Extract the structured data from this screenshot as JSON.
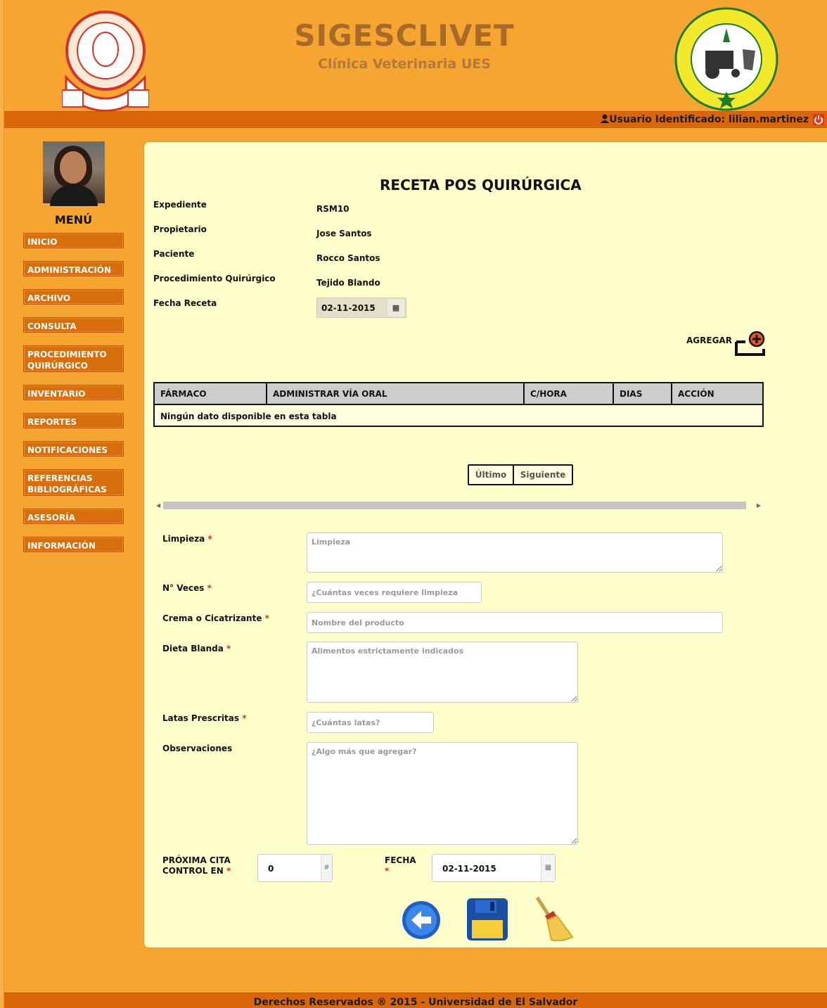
{
  "header": {
    "title": "SIGESCLIVET",
    "subtitle": "Clínica Veterinaria UES",
    "user_label": "Usuario Identificado: lilian.martinez",
    "left_logo": "universidad-de-el-salvador-seal",
    "right_logo": "facultad-de-ciencias-agronomicas-seal",
    "colors": {
      "background": "#f6a531",
      "bar": "#d9670a",
      "panel": "#ffffcc",
      "menu": "#d96e0d"
    }
  },
  "sidebar": {
    "menu_title": "MENÚ",
    "items": [
      {
        "label": "INICIO"
      },
      {
        "label": "ADMINISTRACIÓN"
      },
      {
        "label": "ARCHIVO"
      },
      {
        "label": "CONSULTA"
      },
      {
        "label": "PROCEDIMIENTO QUIRÚRGICO"
      },
      {
        "label": "INVENTARIO"
      },
      {
        "label": "REPORTES"
      },
      {
        "label": "NOTIFICACIONES"
      },
      {
        "label": "REFERENCIAS BIBLIOGRÁFICAS"
      },
      {
        "label": "ASESORÍA"
      },
      {
        "label": "INFORMACIÓN"
      }
    ]
  },
  "main": {
    "title": "RECETA POS QUIRÚRGICA",
    "info": [
      {
        "label": "Expediente",
        "value": "RSM10"
      },
      {
        "label": "Propietario",
        "value": "Jose Santos"
      },
      {
        "label": "Paciente",
        "value": "Rocco Santos"
      },
      {
        "label": "Procedimiento Quirúrgico",
        "value": "Tejido Blando"
      },
      {
        "label": "Fecha Receta",
        "value": "02-11-2015"
      }
    ],
    "agregar_label": "AGREGAR",
    "table": {
      "columns": [
        "FÁRMACO",
        "ADMINISTRAR VÍA ORAL",
        "C/HORA",
        "DIAS",
        "ACCIÓN"
      ],
      "empty_message": "Ningún dato disponible en esta tabla"
    },
    "pager": {
      "last_label": "Último",
      "next_label": "Siguiente"
    },
    "form": {
      "limpieza": {
        "label": "Limpieza",
        "placeholder": "Limpieza"
      },
      "veces": {
        "label": "N° Veces",
        "placeholder": "¿Cuántas veces requiere limpieza"
      },
      "crema": {
        "label": "Crema o Cicatrizante",
        "placeholder": "Nombre del producto"
      },
      "dieta": {
        "label": "Dieta Blanda",
        "placeholder": "Alimentos estrictamente indicados"
      },
      "latas": {
        "label": "Latas Prescritas",
        "placeholder": "¿Cuántas latas?"
      },
      "observaciones": {
        "label": "Observaciones",
        "placeholder": "¿Algo más que agregar?"
      },
      "proxima": {
        "label_line1": "PRÓXIMA CITA",
        "label_line2": "CONTROL EN",
        "value": "0",
        "addon": "#"
      },
      "fecha": {
        "label": "FECHA",
        "value": "02-11-2015"
      },
      "required_mark": "*"
    },
    "actions": [
      "back-arrow-icon",
      "save-floppy-icon",
      "clear-broom-icon"
    ]
  },
  "footer": {
    "text": "Derechos Reservados ® 2015 - Universidad de El Salvador"
  }
}
